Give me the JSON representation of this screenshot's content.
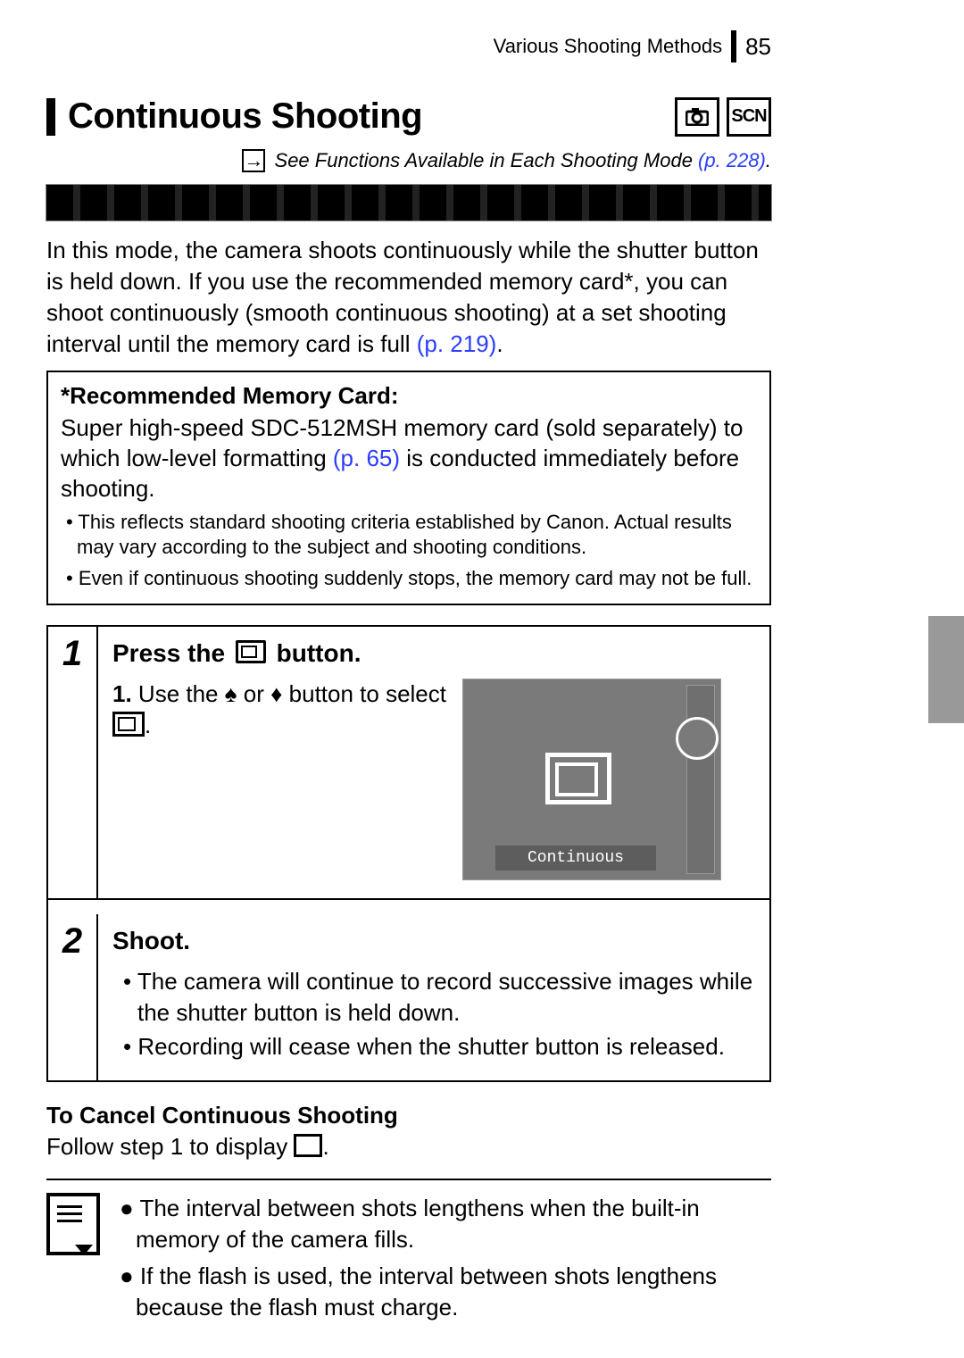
{
  "header": {
    "section": "Various Shooting Methods",
    "page": "85"
  },
  "title": "Continuous Shooting",
  "title_icons": {
    "scn": "SCN"
  },
  "see_line": {
    "arrow": "→",
    "text": " See Functions Available in Each Shooting Mode ",
    "link": "(p. 228)",
    "dot": "."
  },
  "intro": {
    "t1": "In this mode, the camera shoots continuously while the shutter button is held down. If you use the recommended memory card*, you can shoot continuously (smooth continuous shooting) at a set shooting interval until the memory card is full ",
    "link": "(p. 219)",
    "dot": "."
  },
  "box": {
    "heading": "*Recommended Memory Card:",
    "p1a": "Super high-speed SDC-512MSH memory card (sold separately) to which low-level formatting ",
    "link": "(p. 65)",
    "p1b": " is conducted immediately before shooting.",
    "b1": "• This reflects standard shooting criteria established by Canon. Actual results may vary according to the subject and shooting conditions.",
    "b2": "• Even if continuous shooting suddenly stops, the memory card may not be full."
  },
  "steps": {
    "s1": {
      "num": "1",
      "title_a": "Press the ",
      "title_b": " button.",
      "line_num": "1.",
      "line_a": " Use the ",
      "line_b": " or ",
      "line_c": " button to select ",
      "line_d": ".",
      "screen_label": "Continuous"
    },
    "s2": {
      "num": "2",
      "title": "Shoot.",
      "b1": "• The camera will continue to record successive images while the shutter button is held down.",
      "b2": "• Recording will cease when the shutter button is released."
    }
  },
  "cancel": {
    "h": "To Cancel Continuous Shooting",
    "t": "Follow step 1 to display ",
    "dot": "."
  },
  "notes": {
    "n1": "● The interval between shots lengthens when the built-in memory of the camera fills.",
    "n2": "● If the flash is used, the interval between shots lengthens because the flash must charge."
  }
}
